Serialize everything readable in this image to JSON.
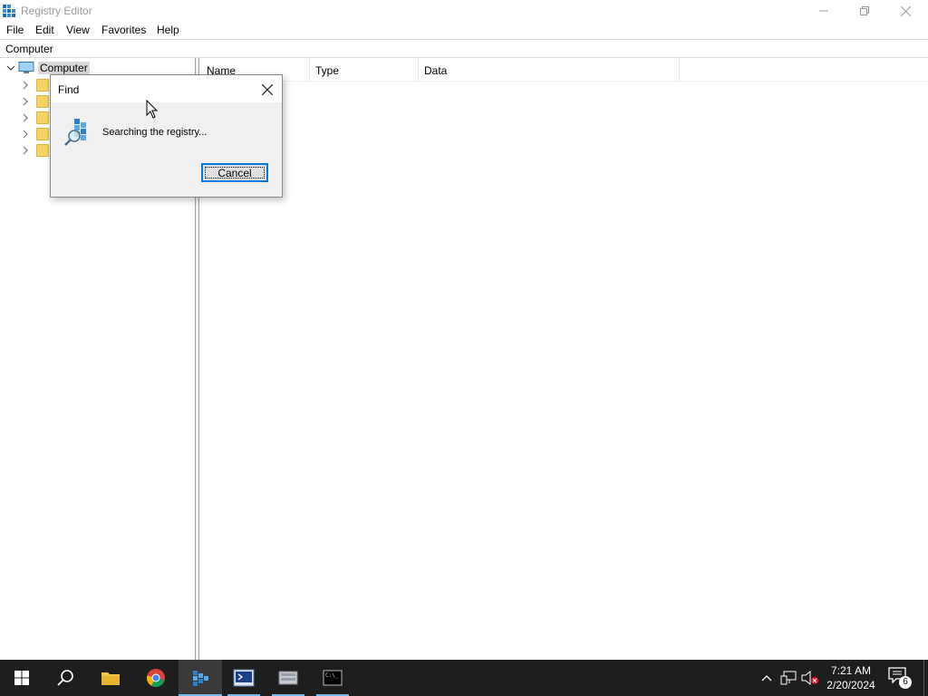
{
  "window": {
    "title": "Registry Editor",
    "app_icon": "regedit-icon",
    "controls": [
      "minimize-icon",
      "restore-icon",
      "close-icon"
    ]
  },
  "menu": [
    "File",
    "Edit",
    "View",
    "Favorites",
    "Help"
  ],
  "address": "Computer",
  "tree": {
    "root_label": "Computer",
    "child_count": 5
  },
  "list": {
    "columns": [
      "Name",
      "Type",
      "Data"
    ]
  },
  "find_dialog": {
    "title": "Find",
    "message": "Searching the registry...",
    "cancel_label": "Cancel"
  },
  "taskbar": {
    "apps": [
      "start-icon",
      "search-icon",
      "file-explorer-icon",
      "chrome-icon",
      "regedit-icon",
      "powershell-icon",
      "server-manager-icon",
      "cmd-icon"
    ],
    "active_app": "regedit-icon",
    "time": "7:21 AM",
    "date": "2/20/2024",
    "notification_count": "6"
  },
  "colors": {
    "taskbar": "#1e1e1e",
    "accent": "#0078d7",
    "folder": "#f6d365"
  }
}
